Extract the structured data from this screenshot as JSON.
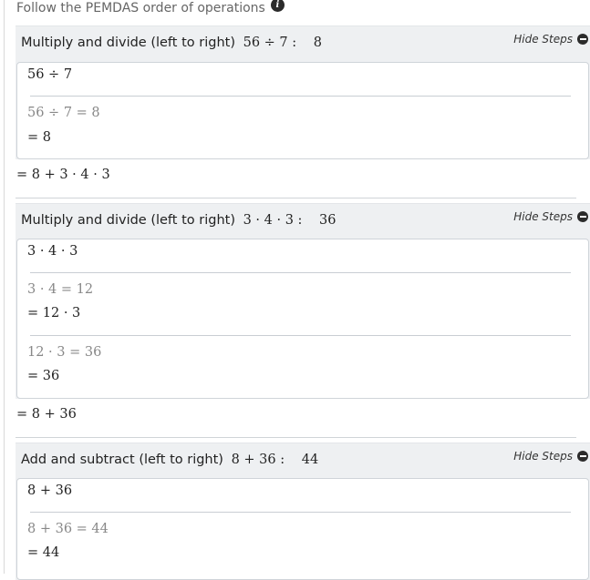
{
  "header": {
    "text": "Follow the PEMDAS order of operations",
    "info_icon": "i"
  },
  "hide_steps_label": "Hide Steps",
  "sections": [
    {
      "title": "Multiply and divide (left to right)",
      "expr": "56 ÷ 7 :",
      "result": "8",
      "inner_expr": "56 ÷ 7",
      "steps": [
        {
          "calc": "56 ÷ 7 = 8",
          "res": "= 8"
        }
      ]
    },
    {
      "title": "Multiply and divide (left to right)",
      "expr": "3 · 4 · 3 :",
      "result": "36",
      "inner_expr": "3 · 4 · 3",
      "steps": [
        {
          "calc": "3 · 4 = 12",
          "res": "= 12 · 3"
        },
        {
          "calc": "12 · 3 = 36",
          "res": "= 36"
        }
      ]
    },
    {
      "title": "Add and subtract (left to right)",
      "expr": "8 + 36 :",
      "result": "44",
      "inner_expr": "8 + 36",
      "steps": [
        {
          "calc": "8 + 36 = 44",
          "res": "= 44"
        }
      ]
    }
  ],
  "results": [
    "= 8 + 3 · 4 · 3",
    "= 8 + 36"
  ]
}
